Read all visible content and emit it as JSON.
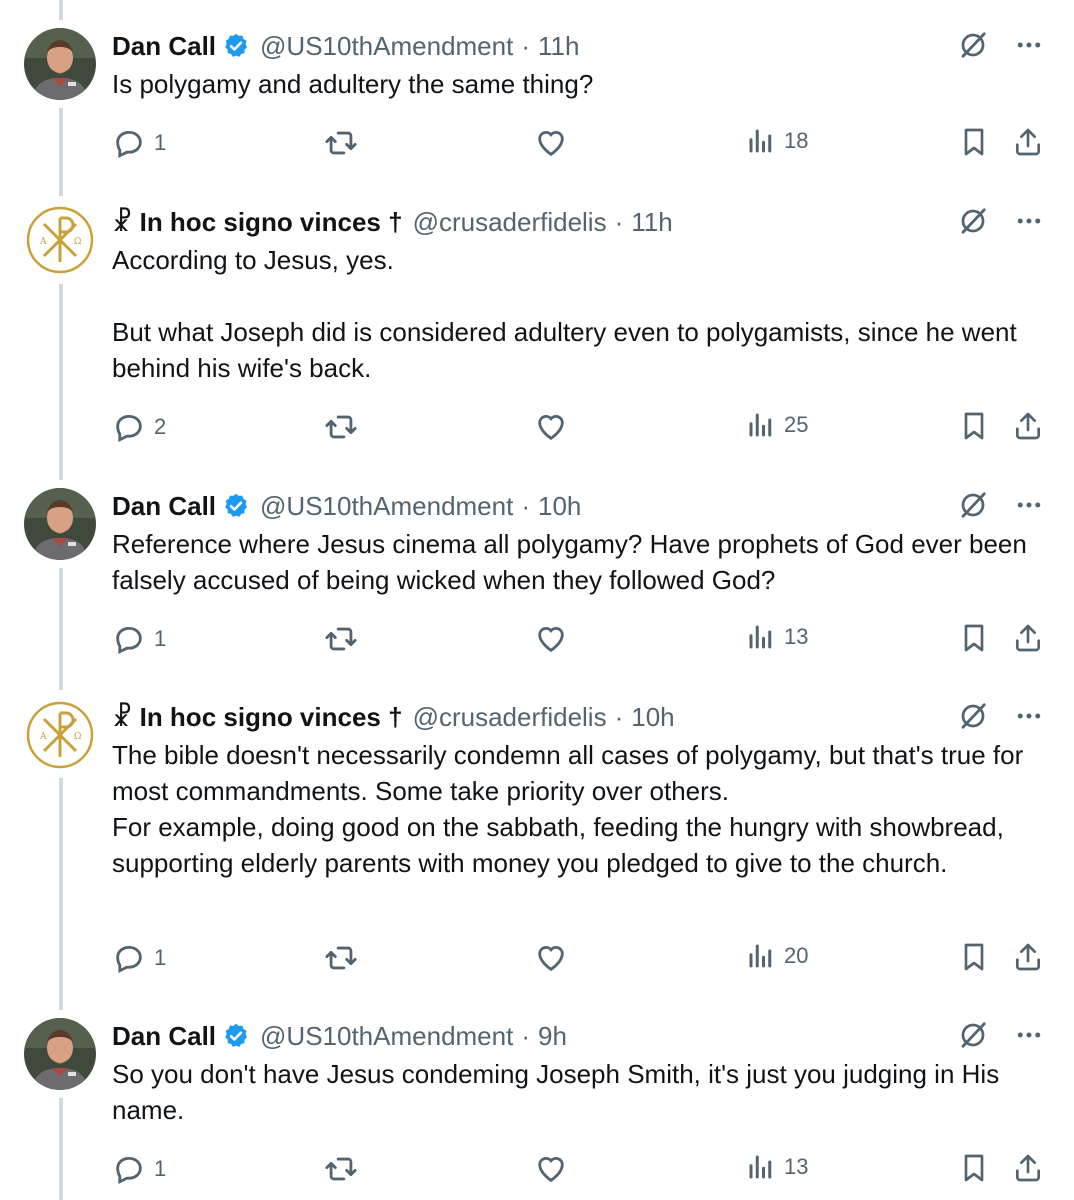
{
  "tweets": [
    {
      "author": "Dan Call",
      "verified": true,
      "handle": "@US10thAmendment",
      "time": "11h",
      "text": "Is polygamy and adultery the same thing?",
      "replies": "1",
      "views": "18",
      "avatar": "person-photo"
    },
    {
      "author": "☧ In hoc signo vinces †",
      "verified": false,
      "handle": "@crusaderfidelis",
      "time": "11h",
      "text": "According to Jesus, yes.\n\nBut what Joseph did is considered adultery even to polygamists, since he went behind his wife's back.",
      "replies": "2",
      "views": "25",
      "avatar": "chi-rho-logo"
    },
    {
      "author": "Dan Call",
      "verified": true,
      "handle": "@US10thAmendment",
      "time": "10h",
      "text": "Reference where Jesus cinema all polygamy? Have prophets of God ever been falsely accused of being wicked when they followed God?",
      "replies": "1",
      "views": "13",
      "avatar": "person-photo"
    },
    {
      "author": "☧ In hoc signo vinces †",
      "verified": false,
      "handle": "@crusaderfidelis",
      "time": "10h",
      "text": "The bible doesn't necessarily condemn all cases of polygamy, but that's true for most commandments. Some take priority over others.\nFor example, doing good on the sabbath, feeding the hungry with showbread, supporting elderly parents with money you pledged to give to the church.",
      "replies": "1",
      "views": "20",
      "avatar": "chi-rho-logo"
    },
    {
      "author": "Dan Call",
      "verified": true,
      "handle": "@US10thAmendment",
      "time": "9h",
      "text": "So you don't have Jesus condeming Joseph Smith, it's just you judging in His name.",
      "replies": "1",
      "views": "13",
      "avatar": "person-photo"
    }
  ],
  "separator": "·",
  "colors": {
    "verified": "#1d9bf0",
    "muted": "#536471",
    "thread_line": "#cfd9de",
    "gold": "#c9a13b"
  }
}
